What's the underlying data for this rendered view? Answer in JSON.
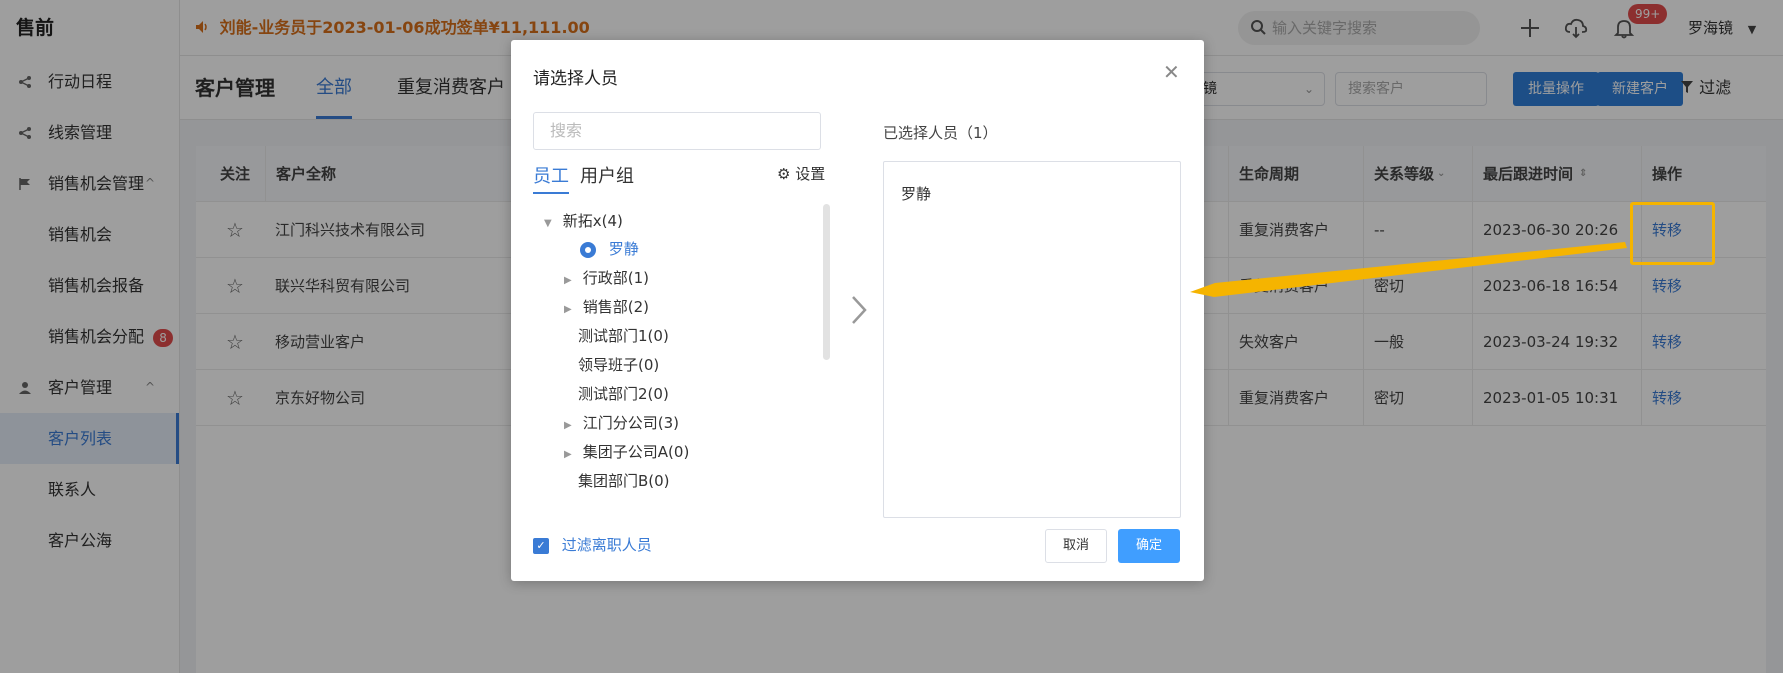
{
  "sidebar": {
    "brand": "售前",
    "items": [
      {
        "label": "行动日程",
        "icon": "share-icon"
      },
      {
        "label": "线索管理",
        "icon": "share-icon"
      },
      {
        "label": "销售机会管理",
        "icon": "flag-icon",
        "caret": "^"
      },
      {
        "label": "销售机会"
      },
      {
        "label": "销售机会报备"
      },
      {
        "label": "销售机会分配",
        "badge": "8"
      },
      {
        "label": "客户管理",
        "icon": "user-icon",
        "caret": "^"
      },
      {
        "label": "客户列表"
      },
      {
        "label": "联系人"
      },
      {
        "label": "客户公海"
      }
    ]
  },
  "topbar": {
    "notice": "刘能-业务员于2023-01-06成功签单¥11,111.00",
    "search_placeholder": "输入关键字搜索",
    "notification_count": "99+",
    "user_name": "罗海镜"
  },
  "header": {
    "title": "客户管理",
    "tabs": [
      "全部",
      "重复消费客户"
    ],
    "select_value": "镜",
    "search_placeholder": "搜索客户",
    "batch_button": "批量操作",
    "new_button": "新建客户",
    "filter_label": "过滤"
  },
  "table": {
    "columns": {
      "follow": "关注",
      "name": "客户全称",
      "lifecycle": "生命周期",
      "relation": "关系等级",
      "last_follow": "最后跟进时间",
      "action": "操作"
    },
    "rows": [
      {
        "name": "江门科兴技术有限公司",
        "lifecycle": "重复消费客户",
        "relation": "--",
        "last_follow": "2023-06-30 20:26",
        "action": "转移"
      },
      {
        "name": "联兴华科贸有限公司",
        "lifecycle": "重复消费客户",
        "relation": "密切",
        "last_follow": "2023-06-18 16:54",
        "action": "转移"
      },
      {
        "name": "移动营业客户",
        "lifecycle": "失效客户",
        "relation": "一般",
        "last_follow": "2023-03-24 19:32",
        "action": "转移"
      },
      {
        "name": "京东好物公司",
        "lifecycle": "重复消费客户",
        "relation": "密切",
        "last_follow": "2023-01-05 10:31",
        "action": "转移"
      }
    ]
  },
  "dialog": {
    "title": "请选择人员",
    "search_placeholder": "搜索",
    "tabs": [
      "员工",
      "用户组"
    ],
    "settings_label": "设置",
    "tree": [
      {
        "label": "新拓x(4)",
        "arrow": "▼"
      },
      {
        "label": "罗静",
        "selected": true
      },
      {
        "label": "行政部(1)",
        "arrow": "▶"
      },
      {
        "label": "销售部(2)",
        "arrow": "▶"
      },
      {
        "label": "测试部门1(0)"
      },
      {
        "label": "领导班子(0)"
      },
      {
        "label": "测试部门2(0)"
      },
      {
        "label": "江门分公司(3)",
        "arrow": "▶"
      },
      {
        "label": "集团子公司A(0)",
        "arrow": "▶"
      },
      {
        "label": "集团部门B(0)"
      }
    ],
    "selected_label": "已选择人员（1）",
    "selected": [
      "罗静"
    ],
    "filter_checkbox": "过滤离职人员",
    "cancel": "取消",
    "confirm": "确定"
  },
  "colors": {
    "accent": "#3a7bd5",
    "notice": "#d9701a",
    "highlight": "#f5b400",
    "badge": "#e34d4d"
  }
}
